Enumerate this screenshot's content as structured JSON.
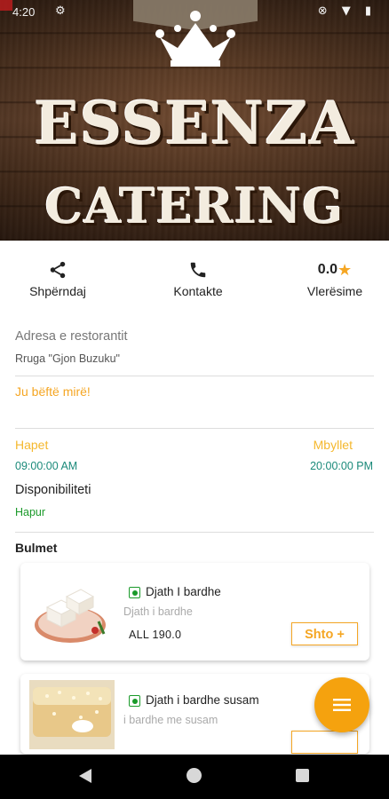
{
  "status_bar": {
    "time": "4:20",
    "gear_icon": "settings-gear",
    "right_icons": "⊗ ▼ ▮"
  },
  "header": {
    "logo_line1": "ESSENZA",
    "logo_line2": "CATERING",
    "crown_icon": "crown"
  },
  "actions": {
    "share": {
      "label": "Shpërndaj",
      "icon": "share-icon"
    },
    "contact": {
      "label": "Kontakte",
      "icon": "phone-icon"
    },
    "rating": {
      "value": "0.0",
      "label": "Vlerësime",
      "icon": "star-icon"
    }
  },
  "restaurant": {
    "address_label": "Adresa e restorantit",
    "address": "Rruga \"Gjon Buzuku\"",
    "greeting": "Ju bëftë mirë!",
    "open_label": "Hapet",
    "close_label": "Mbyllet",
    "open_time": "09:00:00 AM",
    "close_time": "20:00:00 PM",
    "availability_label": "Disponibiliteti",
    "availability_value": "Hapur"
  },
  "menu": {
    "section_title": "Bulmet",
    "items": [
      {
        "name": "Djath I bardhe",
        "description": "Djath i bardhe",
        "price": "ALL 190.0",
        "add_label": "Shto +"
      },
      {
        "name": "Djath i bardhe susam",
        "description": "i bardhe me susam",
        "price": "",
        "add_label": ""
      }
    ]
  },
  "colors": {
    "accent": "#f5a623",
    "teal": "#1b8a7a",
    "green": "#1b9a2a"
  }
}
